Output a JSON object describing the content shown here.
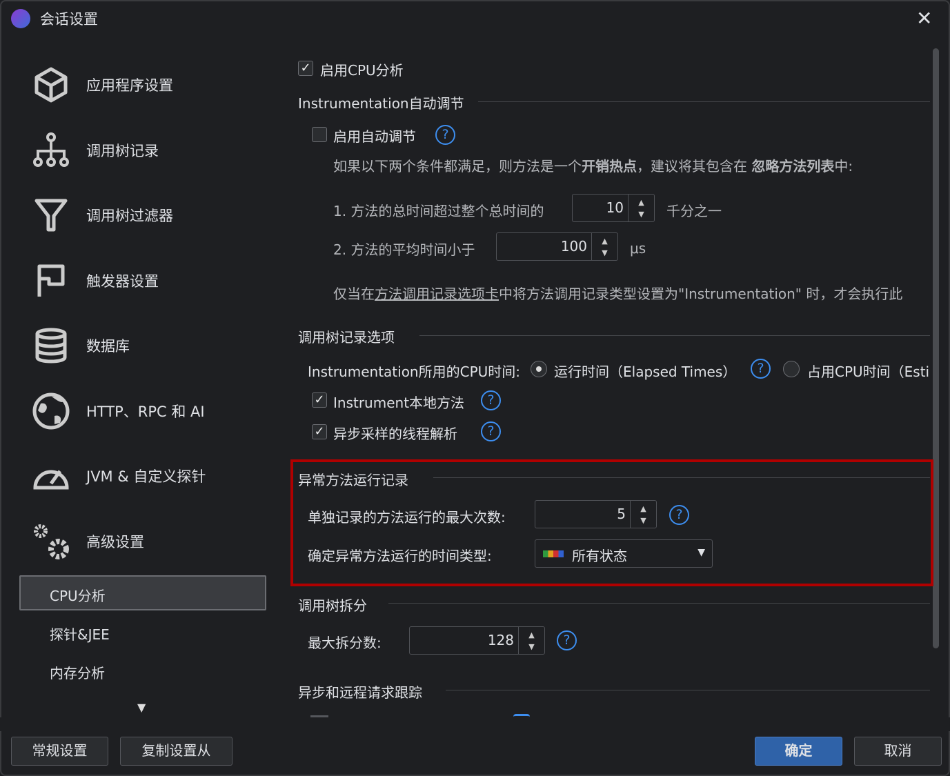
{
  "window": {
    "title": "会话设置",
    "close": "✕"
  },
  "sidebar": {
    "items": [
      {
        "label": "应用程序设置",
        "icon": "cube-icon"
      },
      {
        "label": "调用树记录",
        "icon": "tree-icon"
      },
      {
        "label": "调用树过滤器",
        "icon": "filter-icon"
      },
      {
        "label": "触发器设置",
        "icon": "flag-icon"
      },
      {
        "label": "数据库",
        "icon": "database-icon"
      },
      {
        "label": "HTTP、RPC 和 AI",
        "icon": "globe-icon"
      },
      {
        "label": "JVM & 自定义探针",
        "icon": "gauge-icon"
      },
      {
        "label": "高级设置",
        "icon": "gears-icon"
      }
    ],
    "subitems": [
      "CPU分析",
      "探针&JEE",
      "内存分析"
    ],
    "more": "▼"
  },
  "main": {
    "enable_cpu": "启用CPU分析",
    "auto": {
      "header": "Instrumentation自动调节",
      "enable": "启用自动调节",
      "desc_pre": "如果以下两个条件都满足，则方法是一个",
      "desc_b1": "开销热点",
      "desc_mid": "，建议将其包含在 ",
      "desc_b2": "忽略方法列表",
      "desc_post": "中:",
      "c1": "1. 方法的总时间超过整个总时间的",
      "c1_value": "10",
      "c1_unit": "千分之一",
      "c2": "2. 方法的平均时间小于",
      "c2_value": "100",
      "c2_unit": "μs",
      "note_pre": "仅当在",
      "note_link": "方法调用记录选项卡",
      "note_post": "中将方法调用记录类型设置为\"Instrumentation\" 时，才会执行此"
    },
    "tree": {
      "header": "调用树记录选项",
      "cpu_label": "Instrumentation所用的CPU时间:",
      "opt1": "运行时间（Elapsed Times）",
      "opt2": "占用CPU时间（Esti",
      "native": "Instrument本地方法",
      "async": "异步采样的线程解析"
    },
    "outlier": {
      "header": "异常方法运行记录",
      "max_label": "单独记录的方法运行的最大次数:",
      "max_value": "5",
      "type_label": "确定异常方法运行的时间类型:",
      "type_value": "所有状态"
    },
    "split": {
      "header": "调用树拆分",
      "max_label": "最大拆分数:",
      "max_value": "128"
    },
    "async": {
      "header": "异步和远程请求跟踪"
    }
  },
  "footer": {
    "general": "常规设置",
    "copy": "复制设置从",
    "ok": "确定",
    "cancel": "取消"
  },
  "colors": {
    "accent": "#3d8ef0",
    "highlight": "#b00000",
    "primary": "#2f62a8"
  }
}
